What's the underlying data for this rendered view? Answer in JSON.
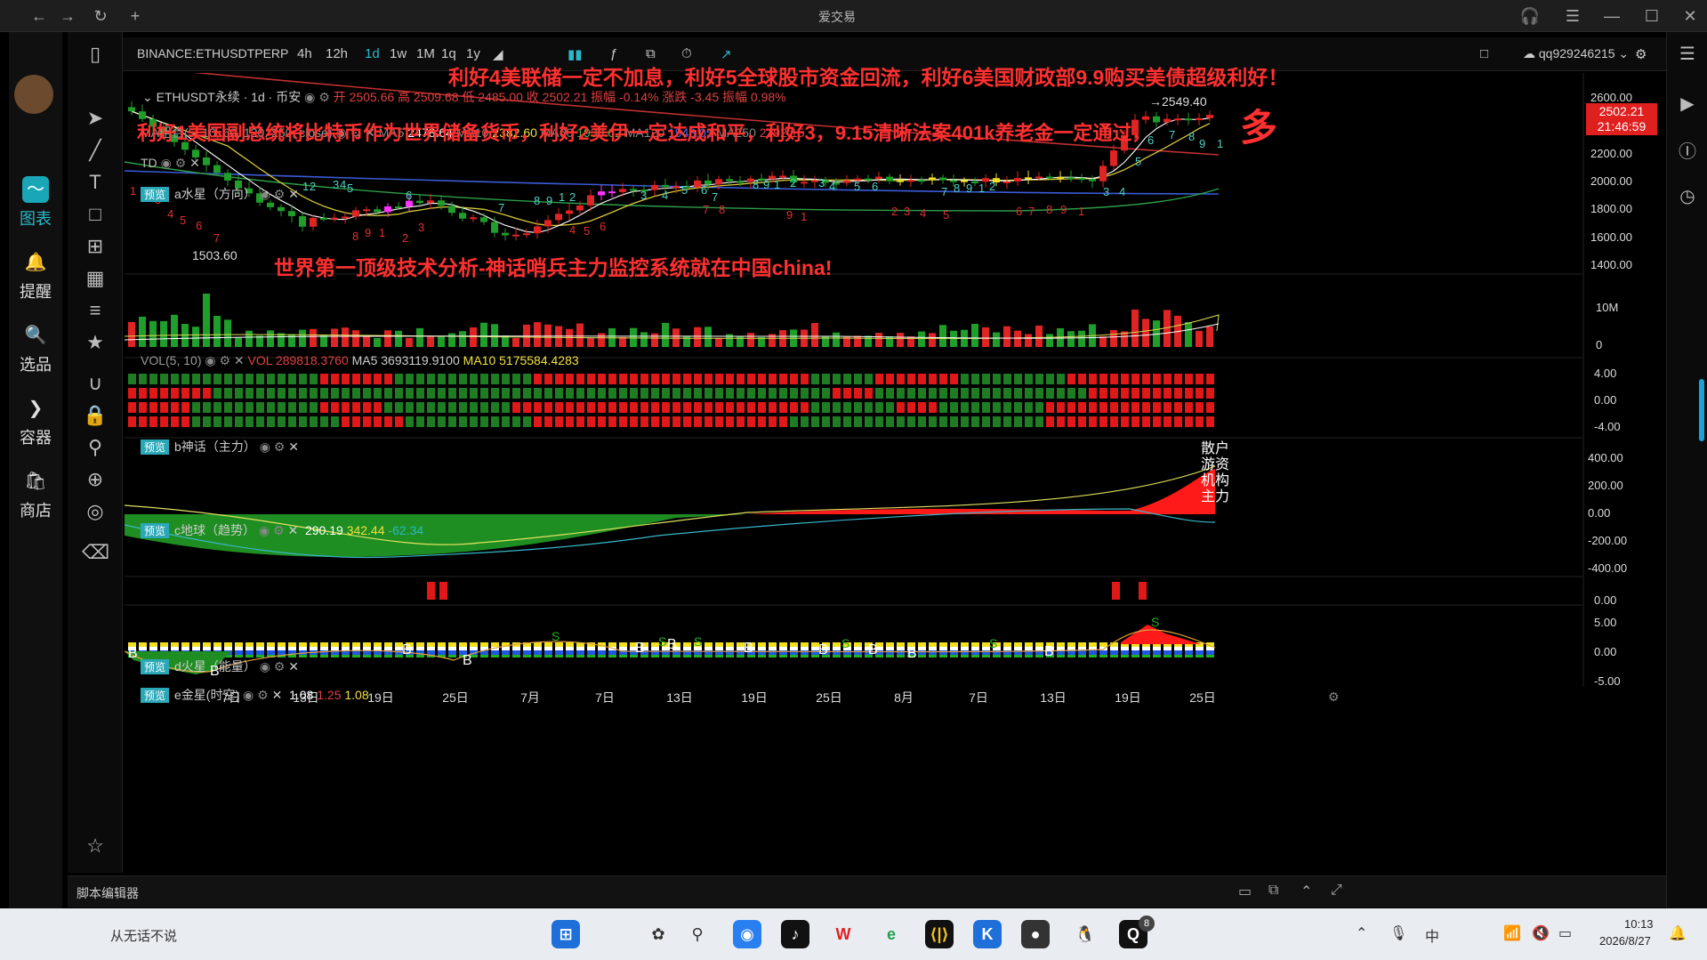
{
  "window": {
    "title": "爱交易"
  },
  "rail": [
    {
      "label": "图表",
      "icon": "chart-icon"
    },
    {
      "label": "提醒",
      "icon": "bell-icon"
    },
    {
      "label": "选品",
      "icon": "search-stats-icon"
    },
    {
      "label": "容器",
      "icon": "container-icon"
    },
    {
      "label": "商店",
      "icon": "store-icon"
    }
  ],
  "toolbar": {
    "symbol": "BINANCE:ETHUSDTPERP",
    "intervals": [
      "4h",
      "12h",
      "1d",
      "1w",
      "1M",
      "1q",
      "1y"
    ],
    "active_interval": "1d",
    "user": "qq929246215"
  },
  "main_panel": {
    "legend": "ETHUSDT永续 · 1d · 币安",
    "ohlc": "开 2505.66 高 2509.68 低 2485.00 收 2502.21 振幅 -0.14% 涨跌 -3.45 振幅 0.98%",
    "ma_label": "MA组合(5, 10, 60, 120, 250, close)",
    "ma": [
      {
        "k": "MA5",
        "v": "2478.64",
        "c": "#ffffff"
      },
      {
        "k": "MA10",
        "v": "2382.60",
        "c": "#f0e040"
      },
      {
        "k": "MA60",
        "v": "1933.62",
        "c": "#3fb950"
      },
      {
        "k": "MA120",
        "v": "1948.05",
        "c": "#4a6cf7"
      },
      {
        "k": "MA250",
        "v": "2192.15",
        "c": "#e04040"
      }
    ],
    "td_label": "TD",
    "indicator": "a水星（方向）",
    "low_label": "1503.60",
    "high_label": "2549.40",
    "price_tag": "2502.21",
    "time_tag": "21:46:59",
    "big_char": "多",
    "banner1": "利好4美联储一定不加息，利好5全球股市资金回流，利好6美国财政部9.9购买美债超级利好！",
    "banner2": "利好1美国副总统将比特币作为世界储备货币，利好2美伊一定达成和平，利好3，9.15清晰法案401k养老金一定通过，",
    "banner3": "世界第一顶级技术分析-神话哨兵主力监控系统就在中国china!"
  },
  "price_axis": [
    "2800.00",
    "2600.00",
    "2400.00",
    "2200.00",
    "2000.00",
    "1800.00",
    "1600.00",
    "1400.00"
  ],
  "vol_panel": {
    "label": "VOL(5, 10)",
    "vol": "VOL 289818.3760",
    "ma5": "MA5 3693119.9100",
    "ma10": "MA10 5175584.4283",
    "axis": [
      "10M",
      "0"
    ]
  },
  "b_panel": {
    "label": "b神话（主力）",
    "rows": [
      "散户",
      "游资",
      "机构",
      "主力"
    ],
    "axis": [
      "4.00",
      "0.00",
      "-4.00"
    ]
  },
  "c_panel": {
    "label": "c地球（趋势）",
    "v1": "290.19",
    "v2": "342.44",
    "v3": "-62.34",
    "axis": [
      "400.00",
      "200.00",
      "0.00",
      "-200.00",
      "-400.00"
    ]
  },
  "d_panel": {
    "label": "d火星（能量）",
    "axis": [
      "0.00"
    ]
  },
  "e_panel": {
    "label": "e金星(时空)",
    "v1": "1.08",
    "v2": "1.25",
    "v3": "1.08",
    "axis": [
      "5.00",
      "0.00",
      "-5.00"
    ]
  },
  "preview_tag": "预览",
  "date_axis": [
    "6月",
    "7日",
    "13日",
    "19日",
    "25日",
    "7月",
    "7日",
    "13日",
    "19日",
    "25日",
    "8月",
    "7日",
    "13日",
    "19日",
    "25日"
  ],
  "bottom": {
    "script_editor": "脚本编辑器"
  },
  "taskbar": {
    "search_text": "从无话不说",
    "time": "10:13",
    "date": "2026/8/27",
    "badge": "8"
  }
}
